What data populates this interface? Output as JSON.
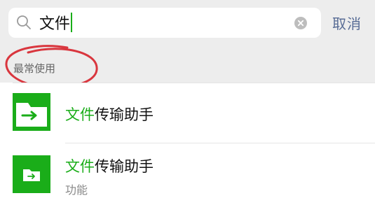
{
  "search": {
    "query": "文件",
    "cancel_label": "取消"
  },
  "section": {
    "title": "最常使用"
  },
  "results": [
    {
      "highlight": "文件",
      "rest": "传瑜助手",
      "subtitle": ""
    },
    {
      "highlight": "文件",
      "rest": "传输助手",
      "subtitle": "功能"
    }
  ],
  "colors": {
    "accent_green": "#1aad19",
    "cancel_blue": "#576b95",
    "annotation_red": "#d9363e"
  },
  "icons": [
    "search-icon",
    "clear-icon",
    "folder-arrow-icon"
  ]
}
